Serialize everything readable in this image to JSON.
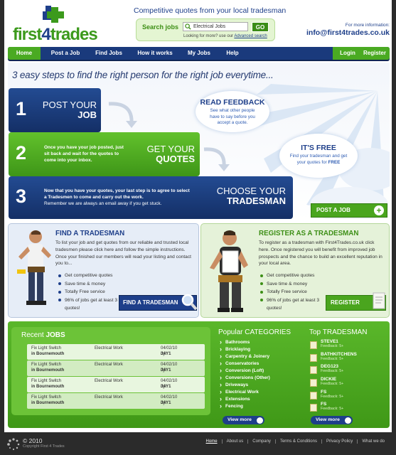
{
  "header": {
    "logo_text_part1": "first",
    "logo_text_part2": "4",
    "logo_text_part3": "trades",
    "tagline": "Competitive quotes from your local tradesman",
    "search": {
      "label": "Search jobs",
      "value": "Electrical Jobs",
      "go_label": "GO",
      "help_text": "Looking for more? use our ",
      "help_link": "Advanced search"
    },
    "contact": {
      "label": "For more information:",
      "email": "info@first4trades.co.uk"
    }
  },
  "nav": {
    "items": [
      "Home",
      "Post a Job",
      "Find Jobs",
      "How it works",
      "My Jobs",
      "Help"
    ],
    "login": "Login",
    "register": "Register"
  },
  "hero": {
    "title": "3 easy steps to find the right person for the right job everytime...",
    "steps": [
      {
        "num": "1",
        "head_line1": "POST YOUR",
        "head_line2": "JOB",
        "desc": ""
      },
      {
        "num": "2",
        "head_line1": "GET YOUR",
        "head_line2": "QUOTES",
        "desc": "Once you have your job posted, just sit back and wait for the quotes to come into your inbox."
      },
      {
        "num": "3",
        "head_line1": "CHOOSE YOUR",
        "head_line2": "TRADESMAN",
        "desc": "Now that you have your quotes, your last step is to agree to select a Tradesmen to come and carry out the work.",
        "desc2": "Remember we are always an email away if you get stuck."
      }
    ],
    "bubble1": {
      "head": "READ FEEDBACK",
      "text": "See what other people have to say before you accept a quote."
    },
    "bubble2": {
      "head": "IT'S FREE",
      "text": "Find your tradesman and get your quotes for ",
      "text_bold": "FREE"
    },
    "post_job_label": "POST A JOB"
  },
  "find_panel": {
    "title": "FIND A TRADESMAN",
    "text": "To list your job and get quotes from our reliable and trusted local tradesmen please click here and follow the simple instructions. Once your finished our members will read your listing and contact you to...",
    "bullets": [
      "Get competitive quotes",
      "Save time & money",
      "Totally Free service",
      "96% of jobs get at least 3 quotes!"
    ],
    "button": "FIND A TRADESMAN"
  },
  "register_panel": {
    "title": "REGISTER AS A TRADESMAN",
    "text": "To register as a tradesman with First4Trades.co.uk click here. Once registered you will benefit from improved job prospects and the chance to build an excellent reputation in your local area.",
    "bullets": [
      "Get competitive quotes",
      "Save time & money",
      "Totally Free service",
      "96% of jobs get at least 3 quotes!"
    ],
    "button": "REGISTER"
  },
  "recent_jobs": {
    "title_light": "Recent ",
    "title_bold": "JOBS",
    "rows": [
      {
        "title": "Fix Light Switch",
        "location": "in Bournemouth",
        "category": "Electrical Work",
        "date": "04/02/10",
        "by_label": "by: ",
        "by": "JAY1"
      },
      {
        "title": "Fix Light Switch",
        "location": "in Bournemouth",
        "category": "Electrical Work",
        "date": "04/02/10",
        "by_label": "by: ",
        "by": "JAY1"
      },
      {
        "title": "Fix Light Switch",
        "location": "in Bournemouth",
        "category": "Electrical Work",
        "date": "04/02/10",
        "by_label": "by: ",
        "by": "JAY1"
      },
      {
        "title": "Fix Light Switch",
        "location": "in Bournemouth",
        "category": "Electrical Work",
        "date": "04/02/10",
        "by_label": "by: ",
        "by": "JAY1"
      }
    ]
  },
  "categories": {
    "title_light": "Popular ",
    "title_bold": "CATEGORIES",
    "items": [
      "Bathrooms",
      "Bricklaying",
      "Carpentry & Joinery",
      "Conservatories",
      "Conversion (Loft)",
      "Conversions (Other)",
      "Driveways",
      "Electrical Work",
      "Extensions",
      "Fencing"
    ],
    "view_more": "View more"
  },
  "top_tradesman": {
    "title_light": "Top ",
    "title_bold": "TRADESMAN",
    "items": [
      {
        "name": "STEVE1",
        "feedback": "Feedback: 5+"
      },
      {
        "name": "BATHKITCHENS",
        "feedback": "Feedback: 5+"
      },
      {
        "name": "DEG123",
        "feedback": "Feedback: 5+"
      },
      {
        "name": "DICKIE",
        "feedback": "Feedback: 5+"
      },
      {
        "name": "FS",
        "feedback": "Feedback: 5+"
      },
      {
        "name": "FS",
        "feedback": "Feedback: 5+"
      }
    ],
    "view_more": "View more"
  },
  "footer": {
    "copyright_year": "© 2010",
    "copyright_text": "Copyright First 4 Trades",
    "links": [
      "Home",
      "About us",
      "Company",
      "Terms & Conditions",
      "Privacy Policy",
      "What we do"
    ]
  },
  "colors": {
    "brand_green": "#4aaa22",
    "brand_blue": "#1a3a7c",
    "footer_bg": "#2b2b2b"
  }
}
